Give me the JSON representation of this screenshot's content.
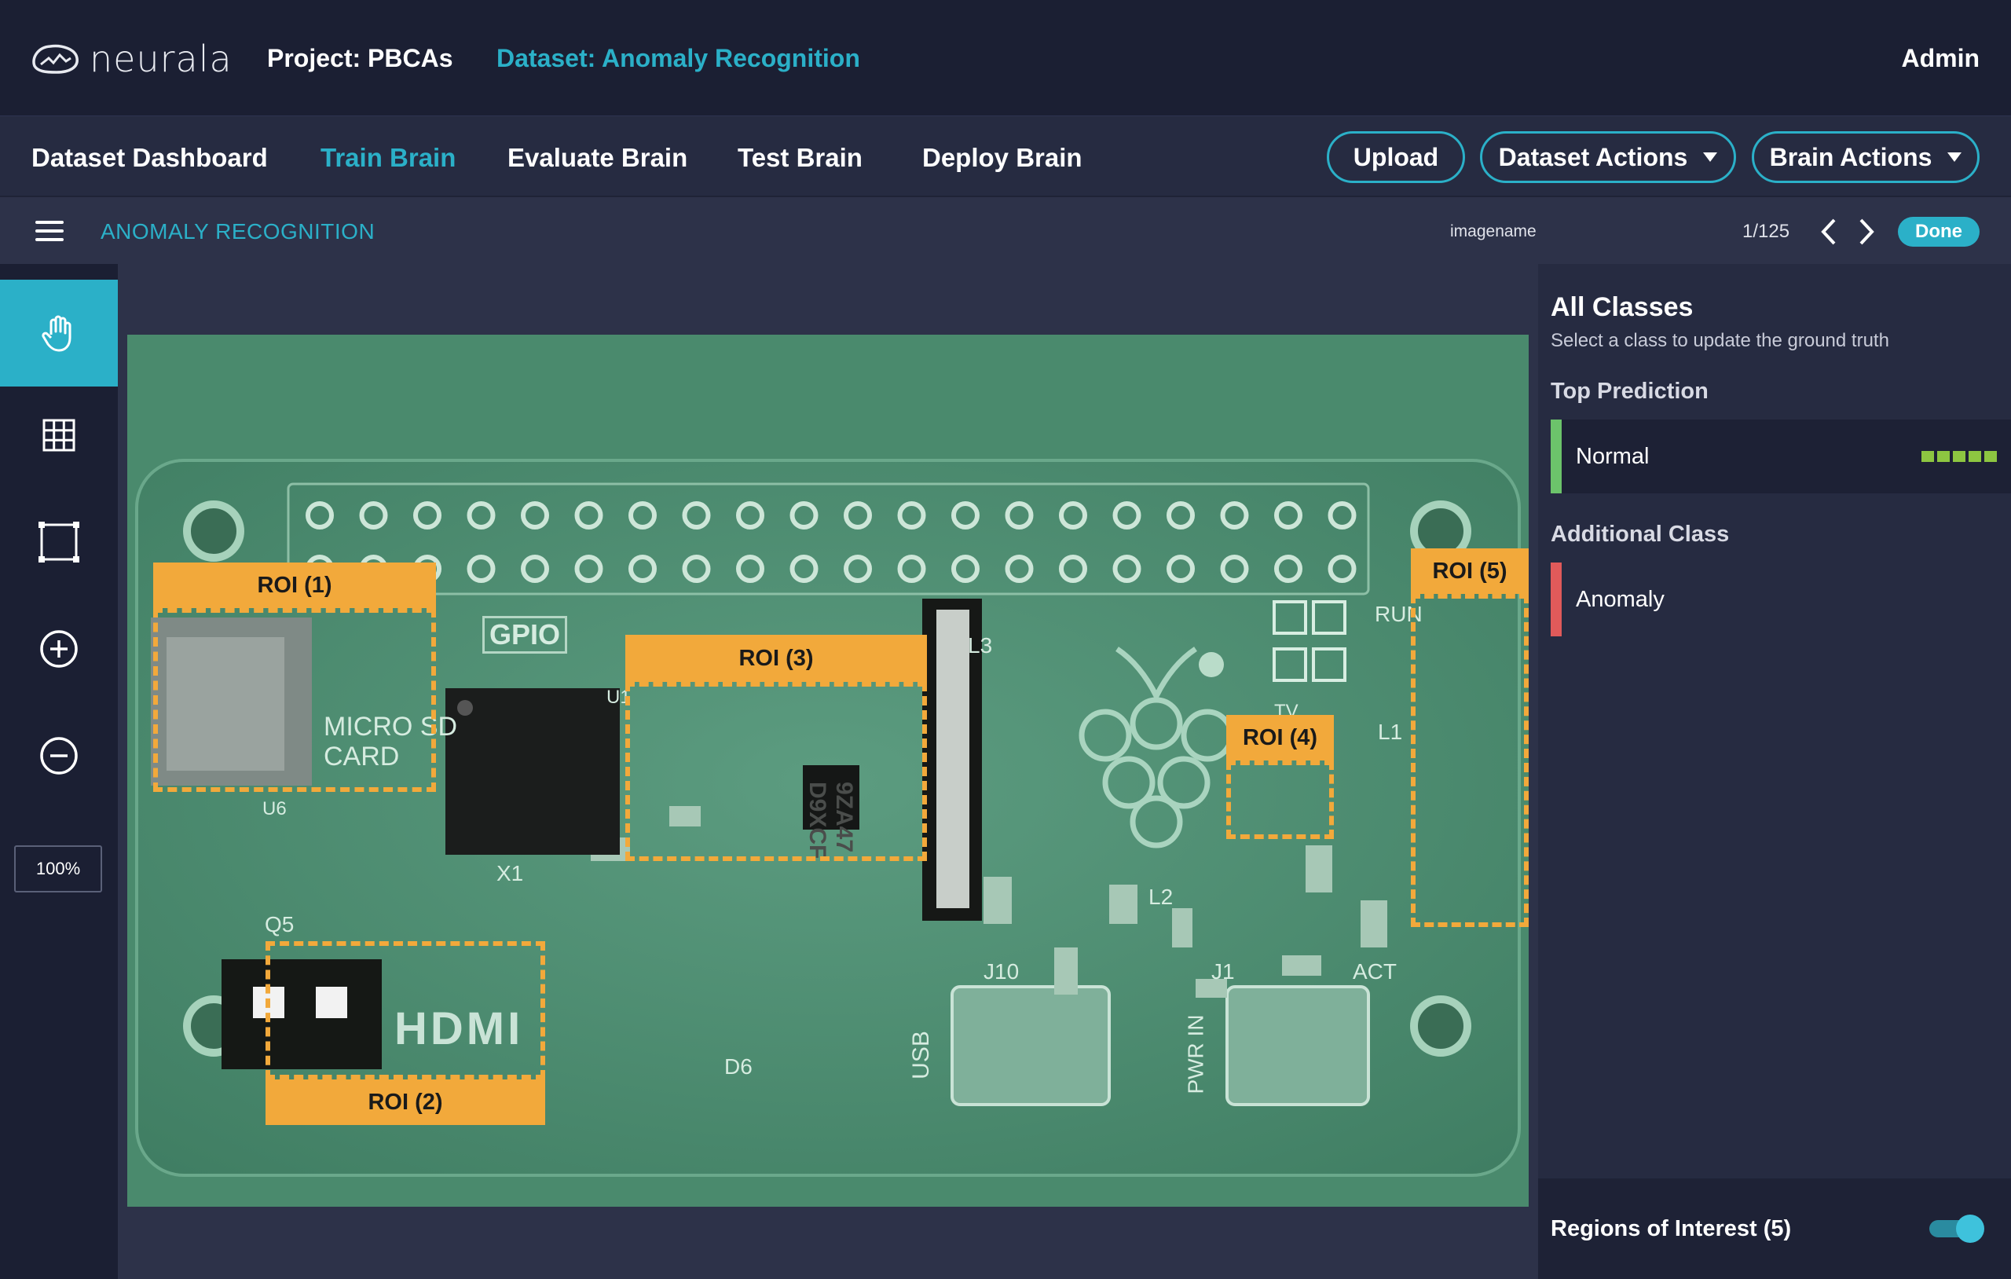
{
  "header": {
    "logo_text": "neurala",
    "project": "Project: PBCAs",
    "dataset": "Dataset: Anomaly Recognition",
    "user": "Admin"
  },
  "nav": {
    "items": [
      {
        "label": "Dataset Dashboard",
        "active": false
      },
      {
        "label": "Train Brain",
        "active": true
      },
      {
        "label": "Evaluate Brain",
        "active": false
      },
      {
        "label": "Test Brain",
        "active": false
      },
      {
        "label": "Deploy Brain",
        "active": false
      }
    ],
    "upload_label": "Upload",
    "dataset_actions_label": "Dataset Actions",
    "brain_actions_label": "Brain Actions"
  },
  "toolbar": {
    "title": "ANOMALY RECOGNITION",
    "imagename": "imagename",
    "counter": "1/125",
    "done_label": "Done"
  },
  "tools": {
    "items": [
      "hand-icon",
      "grid-icon",
      "bounding-box-icon",
      "zoom-in-icon",
      "zoom-out-icon"
    ],
    "zoom": "100%"
  },
  "canvas": {
    "rois": [
      {
        "label": "ROI (1)"
      },
      {
        "label": "ROI (2)"
      },
      {
        "label": "ROI (3)"
      },
      {
        "label": "ROI (4)"
      },
      {
        "label": "ROI (5)"
      }
    ],
    "board_text": {
      "gpio": "GPIO",
      "sdcard": "MICRO SD CARD",
      "hdmi": "HDMI",
      "usb": "USB",
      "pwr": "PWR IN",
      "j10": "J10",
      "j1": "J1",
      "act": "ACT",
      "run": "RUN",
      "tv": "TV",
      "l3": "L3",
      "l2": "L2",
      "l1": "L1",
      "x1": "X1",
      "d6": "D6",
      "q5": "Q5",
      "u1": "U1",
      "u6": "U6",
      "chip_code": "9ZA47 D9XCF"
    },
    "roi_color": "#f2a93b"
  },
  "panel": {
    "title": "All Classes",
    "subtitle": "Select a class to update the ground truth",
    "top_prediction_heading": "Top Prediction",
    "top_prediction": {
      "name": "Normal",
      "color": "#6cc36b",
      "confidence_segments": 5
    },
    "additional_heading": "Additional Class",
    "additional": {
      "name": "Anomaly",
      "color": "#e05a5a"
    },
    "roi_toggle_label": "Regions of Interest (5)",
    "roi_toggle_on": true
  },
  "colors": {
    "accent": "#2bb0c8",
    "bg_dark": "#1b1f33",
    "bg_panel": "#262b41"
  }
}
